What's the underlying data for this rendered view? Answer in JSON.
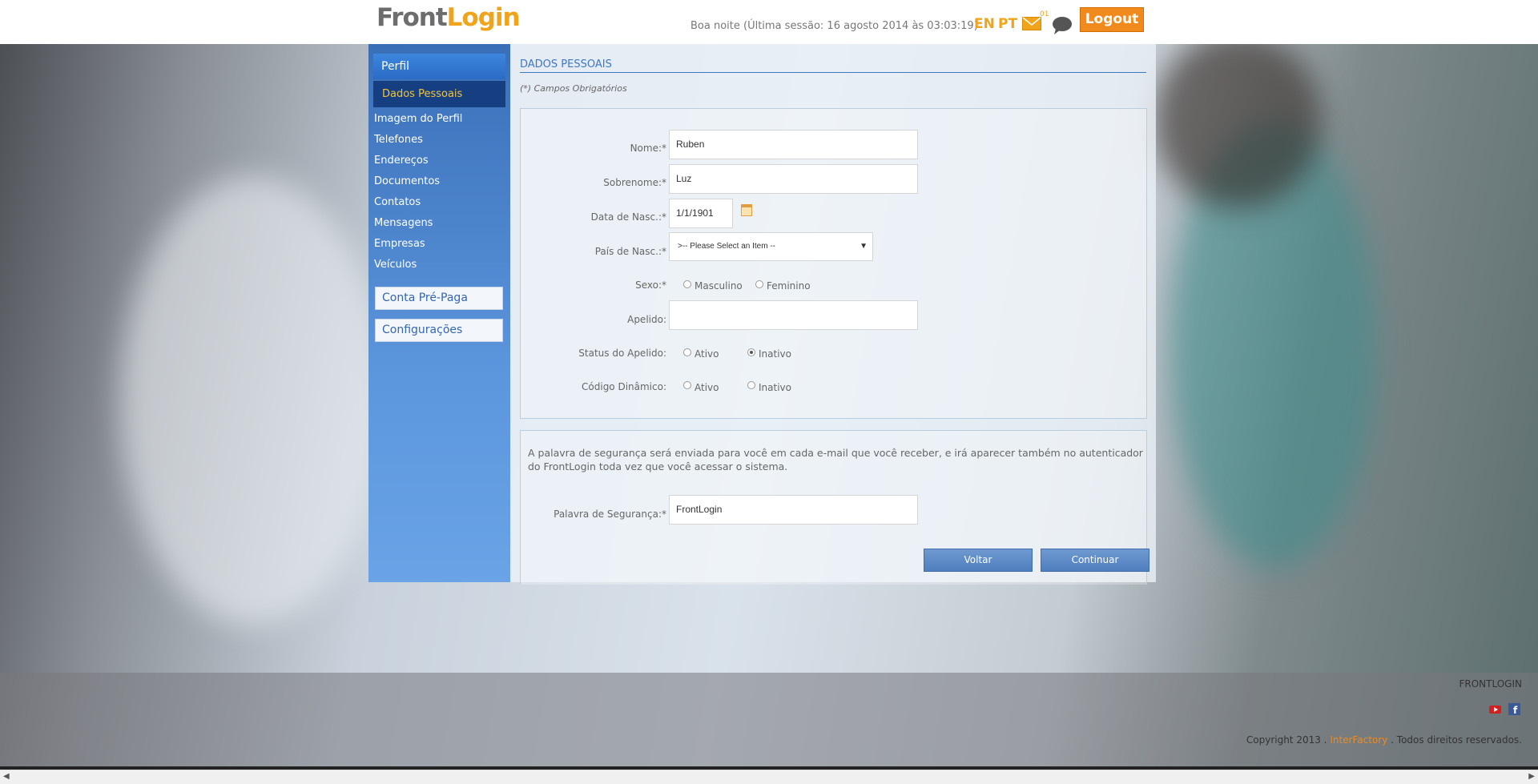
{
  "header": {
    "logo_front": "Front",
    "logo_login": "Login",
    "greeting": "Boa noite (Última sessão: 16 agosto 2014 às 03:03:19)",
    "lang_en": "EN",
    "lang_pt": "PT",
    "mail_icon": "mail-icon",
    "mail_count": "01",
    "chat_icon": "chat-icon",
    "logout": "Logout"
  },
  "sidebar": {
    "heading": "Perfil",
    "active_item": "Dados Pessoais",
    "items": [
      "Imagem do Perfil",
      "Telefones",
      "Endereços",
      "Documentos",
      "Contatos",
      "Mensagens",
      "Empresas",
      "Veículos"
    ],
    "button_prepaid": "Conta Pré-Paga",
    "button_settings": "Configurações"
  },
  "main": {
    "section_title": "DADOS PESSOAIS",
    "required_note": "(*) Campos Obrigatórios",
    "form": {
      "nome_label": "Nome:*",
      "nome_value": "Ruben",
      "sobrenome_label": "Sobrenome:*",
      "sobrenome_value": "Luz",
      "data_label": "Data de Nasc.:*",
      "data_value": "1/1/1901",
      "calendar_icon": "calendar-icon",
      "pais_label": "País de Nasc.:*",
      "pais_value": ">-- Please Select an Item --",
      "sexo_label": "Sexo:*",
      "sexo_options": [
        "Masculino",
        "Feminino"
      ],
      "apelido_label": "Apelido:",
      "apelido_value": "",
      "status_label": "Status do Apelido:",
      "status_options": [
        "Ativo",
        "Inativo"
      ],
      "status_selected": "Inativo",
      "codigo_label": "Código Dinâmico:",
      "codigo_options": [
        "Ativo",
        "Inativo"
      ]
    },
    "security": {
      "info": "A palavra de segurança será enviada para você em cada e-mail que você receber, e irá aparecer também no autenticador do FrontLogin toda vez que você acessar o sistema.",
      "label": "Palavra de Segurança:*",
      "value": "FrontLogin"
    },
    "buttons": {
      "back": "Voltar",
      "continue": "Continuar"
    }
  },
  "footer": {
    "brand": "FRONTLOGIN",
    "icons": [
      "youtube-icon",
      "facebook-icon"
    ],
    "copyright_prefix": "Copyright 2013 .",
    "copyright_link": "InterFactory",
    "copyright_suffix": ". Todos direitos reservados."
  }
}
